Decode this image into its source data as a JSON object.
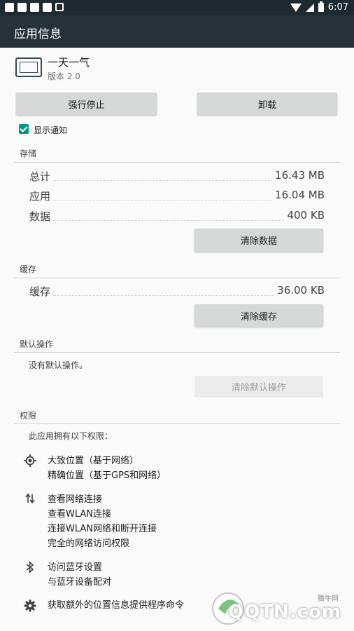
{
  "status_bar": {
    "time": "6:07"
  },
  "app_bar": {
    "title": "应用信息"
  },
  "app": {
    "name": "一天一气",
    "version": "版本 2.0"
  },
  "buttons": {
    "force_stop": "强行停止",
    "uninstall": "卸载"
  },
  "notification": {
    "label": "显示通知",
    "checked": true
  },
  "storage": {
    "header": "存储",
    "rows": [
      {
        "label": "总计",
        "value": "16.43 MB"
      },
      {
        "label": "应用",
        "value": "16.04 MB"
      },
      {
        "label": "数据",
        "value": "400 KB"
      }
    ],
    "clear_button": "清除数据"
  },
  "cache": {
    "header": "缓存",
    "row": {
      "label": "缓存",
      "value": "36.00 KB"
    },
    "clear_button": "清除缓存"
  },
  "defaults": {
    "header": "默认操作",
    "text": "没有默认操作。",
    "clear_button": "清除默认操作"
  },
  "permissions": {
    "header": "权限",
    "intro": "此应用拥有以下权限：",
    "groups": [
      {
        "icon": "location-icon",
        "lines": [
          "大致位置（基于网络）",
          "精确位置（基于GPS和网络）"
        ]
      },
      {
        "icon": "network-arrows-icon",
        "lines": [
          "查看网络连接",
          "查看WLAN连接",
          "连接WLAN网络和断开连接",
          "完全的网络访问权限"
        ]
      },
      {
        "icon": "bluetooth-icon",
        "lines": [
          "访问蓝牙设置",
          "与蓝牙设备配对"
        ]
      },
      {
        "icon": "gear-icon",
        "lines": [
          "获取额外的位置信息提供程序命令"
        ]
      }
    ]
  },
  "watermark": {
    "logo_text": "QQTN.com",
    "small_text": "腾牛网"
  },
  "colors": {
    "app_bar": "#263238",
    "status_bar": "#1f2a30",
    "accent": "#009688"
  }
}
